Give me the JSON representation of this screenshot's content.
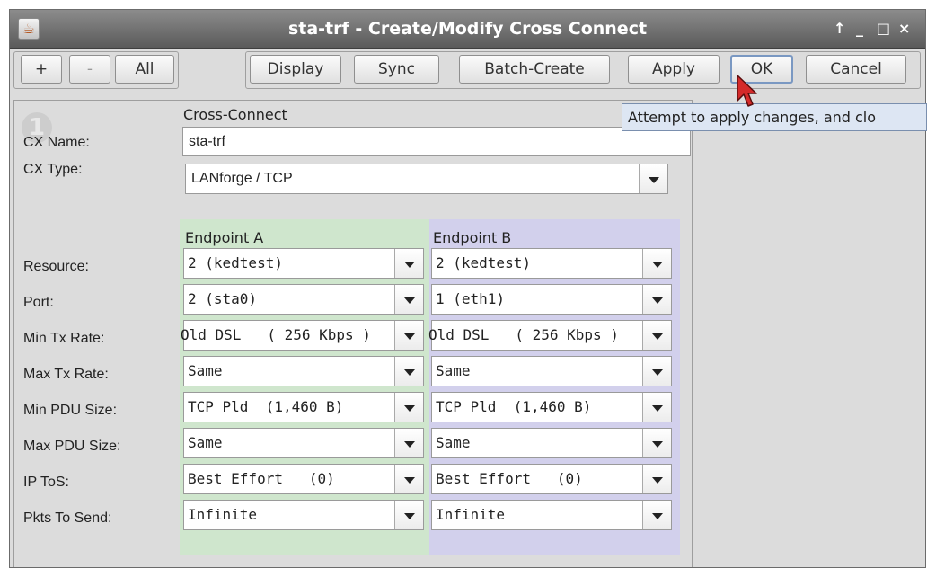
{
  "window": {
    "title": "sta-trf - Create/Modify Cross Connect",
    "app_icon": "java-cup-icon",
    "controls": [
      "↑",
      "_",
      "□",
      "×"
    ]
  },
  "toolbar": {
    "add_label": "+",
    "remove_label": "-",
    "all_label": "All",
    "display_label": "Display",
    "sync_label": "Sync",
    "batch_create_label": "Batch-Create",
    "apply_label": "Apply",
    "ok_label": "OK",
    "cancel_label": "Cancel"
  },
  "tooltip": {
    "text": "Attempt to apply changes, and clo"
  },
  "form": {
    "step_badge": "1",
    "section_title": "Cross-Connect",
    "cx_name_label": "CX Name:",
    "cx_name_value": "sta-trf",
    "cx_type_label": "CX Type:",
    "cx_type_value": "LANforge / TCP",
    "endpoint_a_header": "Endpoint A",
    "endpoint_b_header": "Endpoint B",
    "rows": [
      {
        "label": "Resource:",
        "a": "2 (kedtest)",
        "b": "2 (kedtest)"
      },
      {
        "label": "Port:",
        "a": "2 (sta0)",
        "b": "1 (eth1)"
      },
      {
        "label": "Min Tx Rate:",
        "a": "Old DSL   ( 256 Kbps )",
        "b": "Old DSL   ( 256 Kbps )"
      },
      {
        "label": "Max Tx Rate:",
        "a": "Same",
        "b": "Same"
      },
      {
        "label": "Min PDU Size:",
        "a": "TCP Pld  (1,460 B)",
        "b": "TCP Pld  (1,460 B)"
      },
      {
        "label": "Max PDU Size:",
        "a": "Same",
        "b": "Same"
      },
      {
        "label": "IP ToS:",
        "a": "Best Effort   (0)",
        "b": "Best Effort   (0)"
      },
      {
        "label": "Pkts To Send:",
        "a": "Infinite",
        "b": "Infinite"
      }
    ]
  },
  "colors": {
    "endpoint_a_bg": "#cfe6cd",
    "endpoint_b_bg": "#d2d0ec",
    "titlebar": "#6e6e6e",
    "tooltip_bg": "#dde6f3"
  }
}
